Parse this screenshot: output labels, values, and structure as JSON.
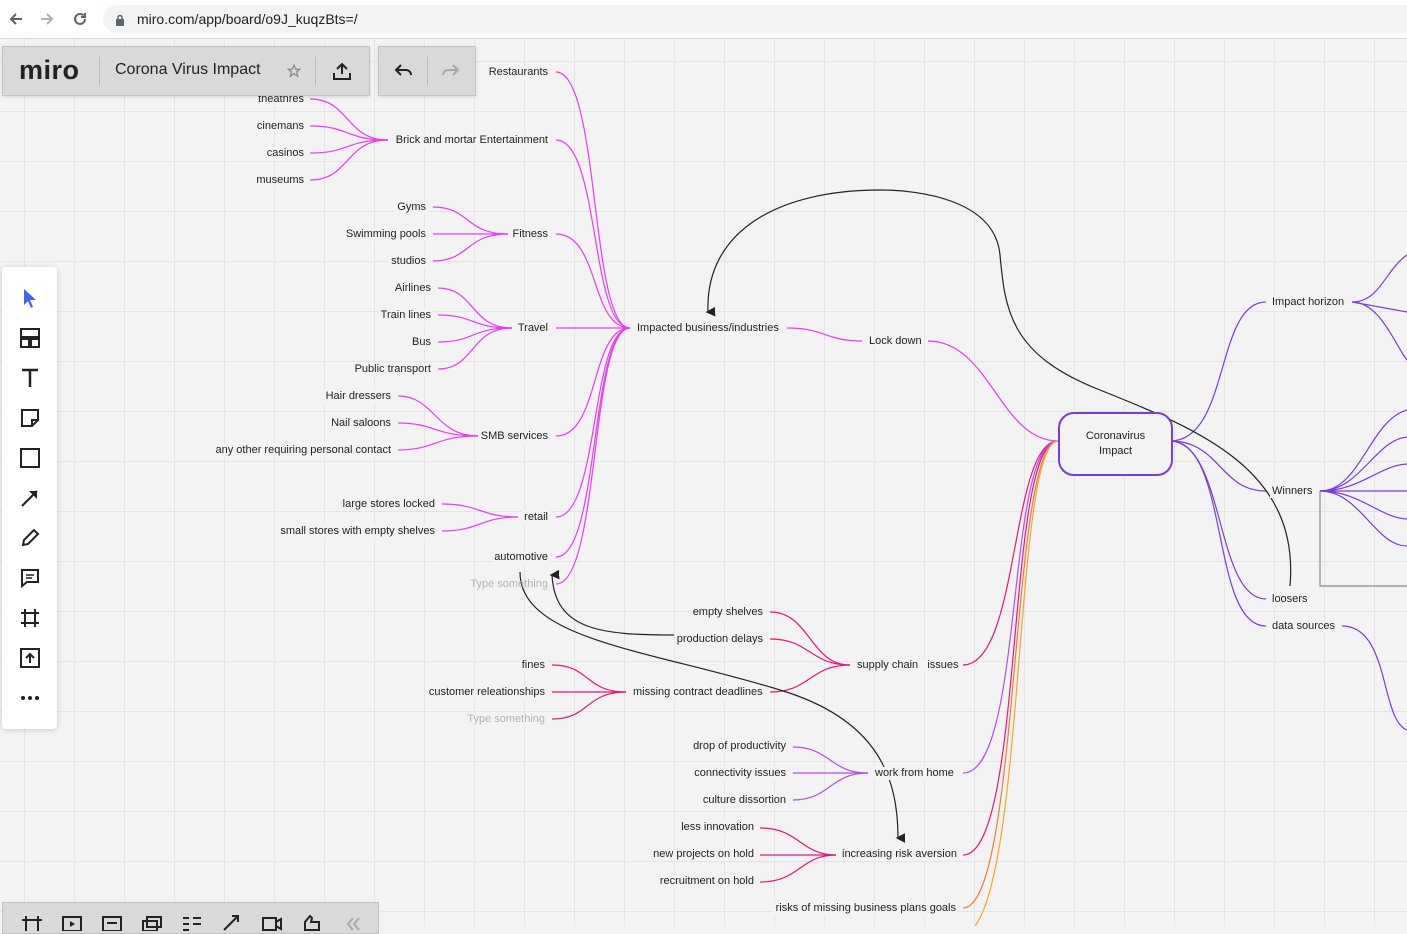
{
  "browser": {
    "url": "miro.com/app/board/o9J_kuqzBts=/",
    "back_icon": "arrow-left-icon",
    "forward_icon": "arrow-right-icon",
    "reload_icon": "reload-icon"
  },
  "header": {
    "logo": "miro",
    "board_title": "Corona Virus Impact",
    "star_icon": "star-icon",
    "share_icon": "upload-icon",
    "undo_icon": "undo-icon",
    "redo_icon": "redo-icon"
  },
  "toolbar": {
    "tools": [
      "select",
      "templates",
      "text",
      "sticky-note",
      "shape",
      "connection-line",
      "pen",
      "comment",
      "frame",
      "upload",
      "more"
    ]
  },
  "colors": {
    "magenta": "#e53ef0",
    "pink_red": "#e8167a",
    "purple": "#8f45f0",
    "violet": "#7a3cde",
    "orange": "#f5a623",
    "black": "#222222"
  },
  "mindmap": {
    "center": "Coronavirus Impact",
    "branches": {
      "lock_down": "Lock down",
      "impacted": "Impacted business/industries",
      "restaurants": "Restaurants",
      "entertainment": "Brick and mortar Entertainment",
      "entertainment_items": [
        "theathres",
        "cinemans",
        "casinos",
        "museums"
      ],
      "fitness": "Fitness",
      "fitness_items": [
        "Gyms",
        "Swimming pools",
        "studios"
      ],
      "travel": "Travel",
      "travel_items": [
        "Airlines",
        "Train lines",
        "Bus",
        "Public transport"
      ],
      "smb": "SMB services",
      "smb_items": [
        "Hair dressers",
        "Nail saloons",
        "any other requiring personal contact"
      ],
      "retail": "retail",
      "retail_items": [
        "large stores locked",
        "small stores with empty shelves"
      ],
      "automotive": "automotive",
      "placeholder": "Type something",
      "supply_chain": "supply chain   issues",
      "supply_items": [
        "empty shelves",
        "production delays"
      ],
      "missing_contract": "missing contract deadlines",
      "contract_items": [
        "fines",
        "customer releationships",
        "Type something"
      ],
      "work_from_home": "work from home",
      "wfh_items": [
        "drop of productivity",
        "connectivity issues",
        "culture dissortion"
      ],
      "risk_aversion": "increasing risk aversion",
      "risk_items": [
        "less innovation",
        "new projects on hold",
        "recruitment on hold"
      ],
      "business_plans": "risks of missing business plans goals",
      "impact_horizon": "Impact horizon",
      "winners": "Winners",
      "loosers": "loosers",
      "data_sources": "data sources"
    }
  }
}
